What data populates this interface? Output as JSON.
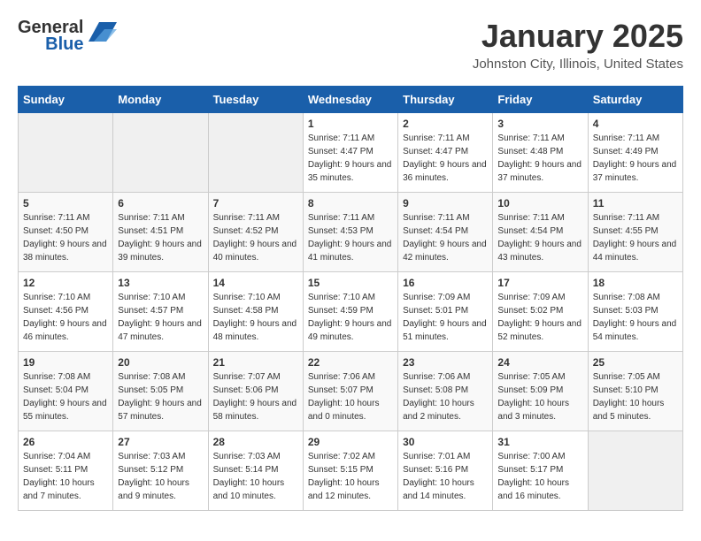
{
  "header": {
    "logo_general": "General",
    "logo_blue": "Blue",
    "title": "January 2025",
    "subtitle": "Johnston City, Illinois, United States"
  },
  "days_of_week": [
    "Sunday",
    "Monday",
    "Tuesday",
    "Wednesday",
    "Thursday",
    "Friday",
    "Saturday"
  ],
  "weeks": [
    [
      {
        "day": "",
        "info": ""
      },
      {
        "day": "",
        "info": ""
      },
      {
        "day": "",
        "info": ""
      },
      {
        "day": "1",
        "info": "Sunrise: 7:11 AM\nSunset: 4:47 PM\nDaylight: 9 hours and 35 minutes."
      },
      {
        "day": "2",
        "info": "Sunrise: 7:11 AM\nSunset: 4:47 PM\nDaylight: 9 hours and 36 minutes."
      },
      {
        "day": "3",
        "info": "Sunrise: 7:11 AM\nSunset: 4:48 PM\nDaylight: 9 hours and 37 minutes."
      },
      {
        "day": "4",
        "info": "Sunrise: 7:11 AM\nSunset: 4:49 PM\nDaylight: 9 hours and 37 minutes."
      }
    ],
    [
      {
        "day": "5",
        "info": "Sunrise: 7:11 AM\nSunset: 4:50 PM\nDaylight: 9 hours and 38 minutes."
      },
      {
        "day": "6",
        "info": "Sunrise: 7:11 AM\nSunset: 4:51 PM\nDaylight: 9 hours and 39 minutes."
      },
      {
        "day": "7",
        "info": "Sunrise: 7:11 AM\nSunset: 4:52 PM\nDaylight: 9 hours and 40 minutes."
      },
      {
        "day": "8",
        "info": "Sunrise: 7:11 AM\nSunset: 4:53 PM\nDaylight: 9 hours and 41 minutes."
      },
      {
        "day": "9",
        "info": "Sunrise: 7:11 AM\nSunset: 4:54 PM\nDaylight: 9 hours and 42 minutes."
      },
      {
        "day": "10",
        "info": "Sunrise: 7:11 AM\nSunset: 4:54 PM\nDaylight: 9 hours and 43 minutes."
      },
      {
        "day": "11",
        "info": "Sunrise: 7:11 AM\nSunset: 4:55 PM\nDaylight: 9 hours and 44 minutes."
      }
    ],
    [
      {
        "day": "12",
        "info": "Sunrise: 7:10 AM\nSunset: 4:56 PM\nDaylight: 9 hours and 46 minutes."
      },
      {
        "day": "13",
        "info": "Sunrise: 7:10 AM\nSunset: 4:57 PM\nDaylight: 9 hours and 47 minutes."
      },
      {
        "day": "14",
        "info": "Sunrise: 7:10 AM\nSunset: 4:58 PM\nDaylight: 9 hours and 48 minutes."
      },
      {
        "day": "15",
        "info": "Sunrise: 7:10 AM\nSunset: 4:59 PM\nDaylight: 9 hours and 49 minutes."
      },
      {
        "day": "16",
        "info": "Sunrise: 7:09 AM\nSunset: 5:01 PM\nDaylight: 9 hours and 51 minutes."
      },
      {
        "day": "17",
        "info": "Sunrise: 7:09 AM\nSunset: 5:02 PM\nDaylight: 9 hours and 52 minutes."
      },
      {
        "day": "18",
        "info": "Sunrise: 7:08 AM\nSunset: 5:03 PM\nDaylight: 9 hours and 54 minutes."
      }
    ],
    [
      {
        "day": "19",
        "info": "Sunrise: 7:08 AM\nSunset: 5:04 PM\nDaylight: 9 hours and 55 minutes."
      },
      {
        "day": "20",
        "info": "Sunrise: 7:08 AM\nSunset: 5:05 PM\nDaylight: 9 hours and 57 minutes."
      },
      {
        "day": "21",
        "info": "Sunrise: 7:07 AM\nSunset: 5:06 PM\nDaylight: 9 hours and 58 minutes."
      },
      {
        "day": "22",
        "info": "Sunrise: 7:06 AM\nSunset: 5:07 PM\nDaylight: 10 hours and 0 minutes."
      },
      {
        "day": "23",
        "info": "Sunrise: 7:06 AM\nSunset: 5:08 PM\nDaylight: 10 hours and 2 minutes."
      },
      {
        "day": "24",
        "info": "Sunrise: 7:05 AM\nSunset: 5:09 PM\nDaylight: 10 hours and 3 minutes."
      },
      {
        "day": "25",
        "info": "Sunrise: 7:05 AM\nSunset: 5:10 PM\nDaylight: 10 hours and 5 minutes."
      }
    ],
    [
      {
        "day": "26",
        "info": "Sunrise: 7:04 AM\nSunset: 5:11 PM\nDaylight: 10 hours and 7 minutes."
      },
      {
        "day": "27",
        "info": "Sunrise: 7:03 AM\nSunset: 5:12 PM\nDaylight: 10 hours and 9 minutes."
      },
      {
        "day": "28",
        "info": "Sunrise: 7:03 AM\nSunset: 5:14 PM\nDaylight: 10 hours and 10 minutes."
      },
      {
        "day": "29",
        "info": "Sunrise: 7:02 AM\nSunset: 5:15 PM\nDaylight: 10 hours and 12 minutes."
      },
      {
        "day": "30",
        "info": "Sunrise: 7:01 AM\nSunset: 5:16 PM\nDaylight: 10 hours and 14 minutes."
      },
      {
        "day": "31",
        "info": "Sunrise: 7:00 AM\nSunset: 5:17 PM\nDaylight: 10 hours and 16 minutes."
      },
      {
        "day": "",
        "info": ""
      }
    ]
  ]
}
